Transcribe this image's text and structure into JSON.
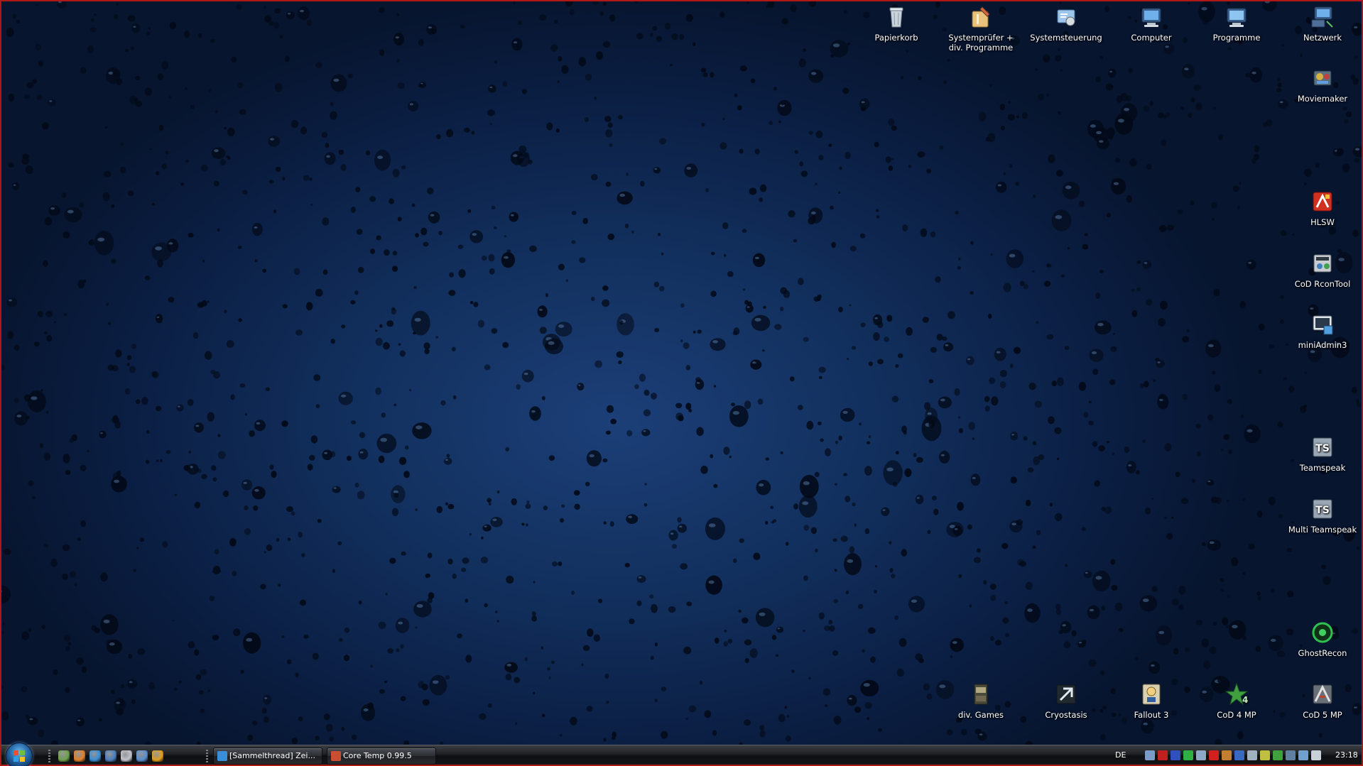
{
  "desktop": {
    "border_color": "#b01818",
    "wallpaper": "blue water drops",
    "icons": [
      {
        "label": "Papierkorb",
        "icon": "recycle-bin-icon"
      },
      {
        "label": "Systemprüfer + div. Programme",
        "icon": "folder-tools-icon"
      },
      {
        "label": "Systemsteuerung",
        "icon": "control-panel-icon"
      },
      {
        "label": "Computer",
        "icon": "computer-icon"
      },
      {
        "label": "Programme",
        "icon": "programs-icon"
      },
      {
        "label": "Netzwerk",
        "icon": "network-icon"
      },
      {
        "label": "Moviemaker",
        "icon": "moviemaker-icon"
      },
      {
        "label": "HLSW",
        "icon": "hlsw-icon"
      },
      {
        "label": "CoD RconTool",
        "icon": "rcontool-icon"
      },
      {
        "label": "miniAdmin3",
        "icon": "miniadmin-icon"
      },
      {
        "label": "Teamspeak",
        "icon": "teamspeak-icon"
      },
      {
        "label": "Multi Teamspeak",
        "icon": "teamspeak-icon"
      },
      {
        "label": "GhostRecon",
        "icon": "ghostrecon-icon"
      },
      {
        "label": "div. Games",
        "icon": "games-folder-icon"
      },
      {
        "label": "Cryostasis",
        "icon": "cryostasis-icon"
      },
      {
        "label": "Fallout 3",
        "icon": "fallout3-icon"
      },
      {
        "label": "CoD 4 MP",
        "icon": "cod4-icon"
      },
      {
        "label": "CoD 5 MP",
        "icon": "cod5-icon"
      }
    ]
  },
  "taskbar": {
    "start_icon": "windows-orb-icon",
    "quick_launch": [
      {
        "icon": "show-desktop-icon",
        "color": "#6da34a"
      },
      {
        "icon": "firefox-icon",
        "color": "#e0802a"
      },
      {
        "icon": "internet-explorer-icon",
        "color": "#3a8ed8"
      },
      {
        "icon": "switch-windows-icon",
        "color": "#4a7fc0"
      },
      {
        "icon": "media-icon",
        "color": "#c0c4cc"
      },
      {
        "icon": "mail-icon",
        "color": "#5a8fd0"
      },
      {
        "icon": "media-player-icon",
        "color": "#e0a020"
      }
    ],
    "tasks": [
      {
        "label": "[Sammelthread] Zei...",
        "icon": "internet-explorer-icon",
        "color": "#3a8ed8"
      },
      {
        "label": "Core Temp 0.99.5",
        "icon": "core-temp-icon",
        "color": "#c85030"
      }
    ],
    "language": "DE",
    "tray_icons": [
      {
        "icon": "headset-icon",
        "color": "#7a9ac8"
      },
      {
        "icon": "red-status-icon",
        "color": "#c02020"
      },
      {
        "icon": "blue-status-icon",
        "color": "#3050c0"
      },
      {
        "icon": "green-status-icon",
        "color": "#30b040"
      },
      {
        "icon": "network-tray-icon",
        "color": "#90a8c8"
      },
      {
        "icon": "ati-icon",
        "color": "#d02020"
      },
      {
        "icon": "shield-icon",
        "color": "#c08030"
      },
      {
        "icon": "blue-app-icon",
        "color": "#3868c0"
      },
      {
        "icon": "monitor-icon",
        "color": "#a0b0c0"
      },
      {
        "icon": "app-tray-icon",
        "color": "#c0c040"
      },
      {
        "icon": "green-app-icon",
        "color": "#40a040"
      },
      {
        "icon": "display-icon",
        "color": "#6080a0"
      },
      {
        "icon": "network-connection-icon",
        "color": "#70a0d0"
      },
      {
        "icon": "volume-icon",
        "color": "#c8d0d8"
      }
    ],
    "clock": "23:18"
  }
}
